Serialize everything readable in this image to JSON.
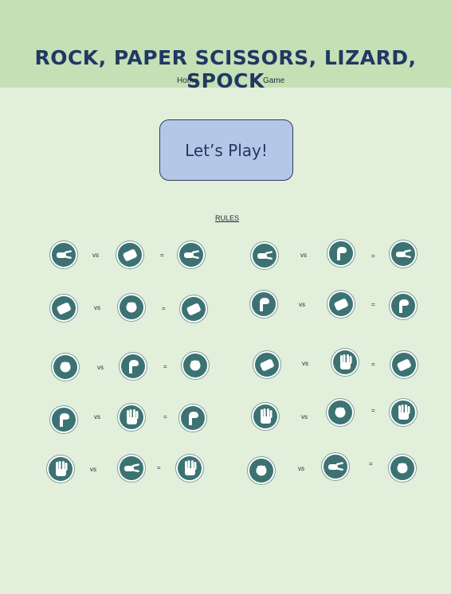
{
  "header": {
    "title": "ROCK, PAPER SCISSORS, LIZARD, SPOCK",
    "nav": [
      {
        "label": "Home"
      },
      {
        "label": "Game"
      }
    ]
  },
  "play_button": {
    "label": "Let’s Play!"
  },
  "rules": {
    "heading": "RULES",
    "vs_label": "vs",
    "equals_label": "=",
    "left_column": [
      {
        "a": "scissors",
        "b": "paper",
        "result": "scissors"
      },
      {
        "a": "paper",
        "b": "rock",
        "result": "paper"
      },
      {
        "a": "rock",
        "b": "lizard",
        "result": "rock"
      },
      {
        "a": "lizard",
        "b": "spock",
        "result": "lizard"
      },
      {
        "a": "spock",
        "b": "scissors",
        "result": "spock"
      }
    ],
    "right_column": [
      {
        "a": "scissors",
        "b": "lizard",
        "result": "scissors"
      },
      {
        "a": "lizard",
        "b": "paper",
        "result": "lizard"
      },
      {
        "a": "paper",
        "b": "spock",
        "result": "paper"
      },
      {
        "a": "spock",
        "b": "rock",
        "result": "spock"
      },
      {
        "a": "rock",
        "b": "scissors",
        "result": "rock"
      }
    ]
  },
  "colors": {
    "header_bg": "#c5e0b4",
    "page_bg": "#e2efda",
    "title": "#1f3864",
    "button_bg": "#b4c7e7",
    "icon_fill": "#3d7272"
  }
}
